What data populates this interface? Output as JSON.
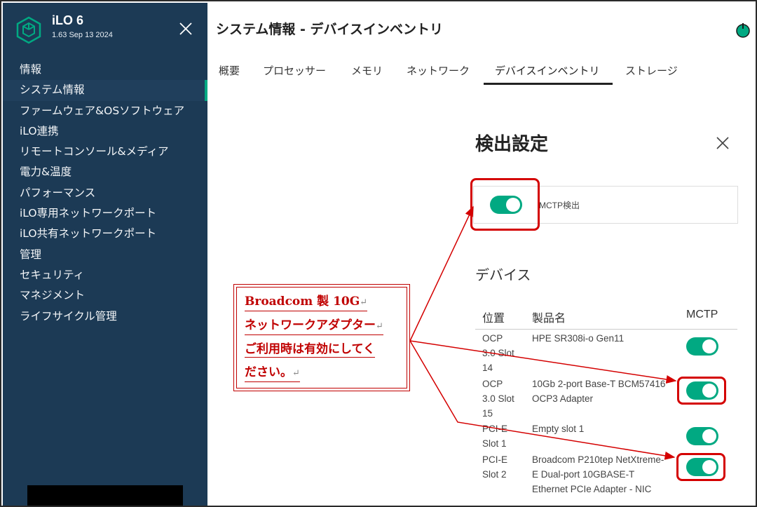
{
  "app": {
    "title": "iLO 6",
    "version": "1.63 Sep 13 2024"
  },
  "sidebar": {
    "items": [
      {
        "label": "情報"
      },
      {
        "label": "システム情報"
      },
      {
        "label": "ファームウェア&OSソフトウェア"
      },
      {
        "label": "iLO連携"
      },
      {
        "label": "リモートコンソール&メディア"
      },
      {
        "label": "電力&温度"
      },
      {
        "label": "パフォーマンス"
      },
      {
        "label": "iLO専用ネットワークポート"
      },
      {
        "label": "iLO共有ネットワークポート"
      },
      {
        "label": "管理"
      },
      {
        "label": "セキュリティ"
      },
      {
        "label": "マネジメント"
      },
      {
        "label": "ライフサイクル管理"
      }
    ],
    "active_item": "システム情報"
  },
  "header": {
    "title": "システム情報 - デバイスインベントリ"
  },
  "tabs": [
    {
      "label": "概要"
    },
    {
      "label": "プロセッサー"
    },
    {
      "label": "メモリ"
    },
    {
      "label": "ネットワーク"
    },
    {
      "label": "デバイスインベントリ"
    },
    {
      "label": "ストレージ"
    }
  ],
  "active_tab": "デバイスインベントリ",
  "dialog": {
    "title": "検出設定",
    "mctp_discovery_label": "MCTP検出",
    "mctp_discovery_enabled": true,
    "section_title": "デバイス",
    "columns": {
      "location": "位置",
      "product": "製品名",
      "mctp": "MCTP"
    },
    "devices": [
      {
        "location": [
          "OCP",
          "3.0 Slot",
          "14"
        ],
        "product": [
          "HPE SR308i-o Gen11"
        ],
        "mctp_enabled": true
      },
      {
        "location": [
          "OCP",
          "3.0 Slot",
          "15"
        ],
        "product": [
          "10Gb 2-port Base-T BCM57416",
          "OCP3 Adapter"
        ],
        "mctp_enabled": true
      },
      {
        "location": [
          "PCI-E",
          "Slot 1"
        ],
        "product": [
          "Empty slot 1"
        ],
        "mctp_enabled": true
      },
      {
        "location": [
          "PCI-E",
          "Slot 2"
        ],
        "product": [
          "Broadcom P210tep NetXtreme-",
          "E Dual-port 10GBASE-T",
          "Ethernet PCIe Adapter - NIC"
        ],
        "mctp_enabled": true
      }
    ]
  },
  "callout": {
    "lines": [
      "Broadcom 製 10G",
      "ネットワークアダプター",
      "ご利用時は有効にしてく",
      "ださい。"
    ],
    "return_mark": "↵"
  },
  "colors": {
    "sidebar_bg": "#1c3a55",
    "accent": "#01a982",
    "annotation_red": "#d40000"
  }
}
